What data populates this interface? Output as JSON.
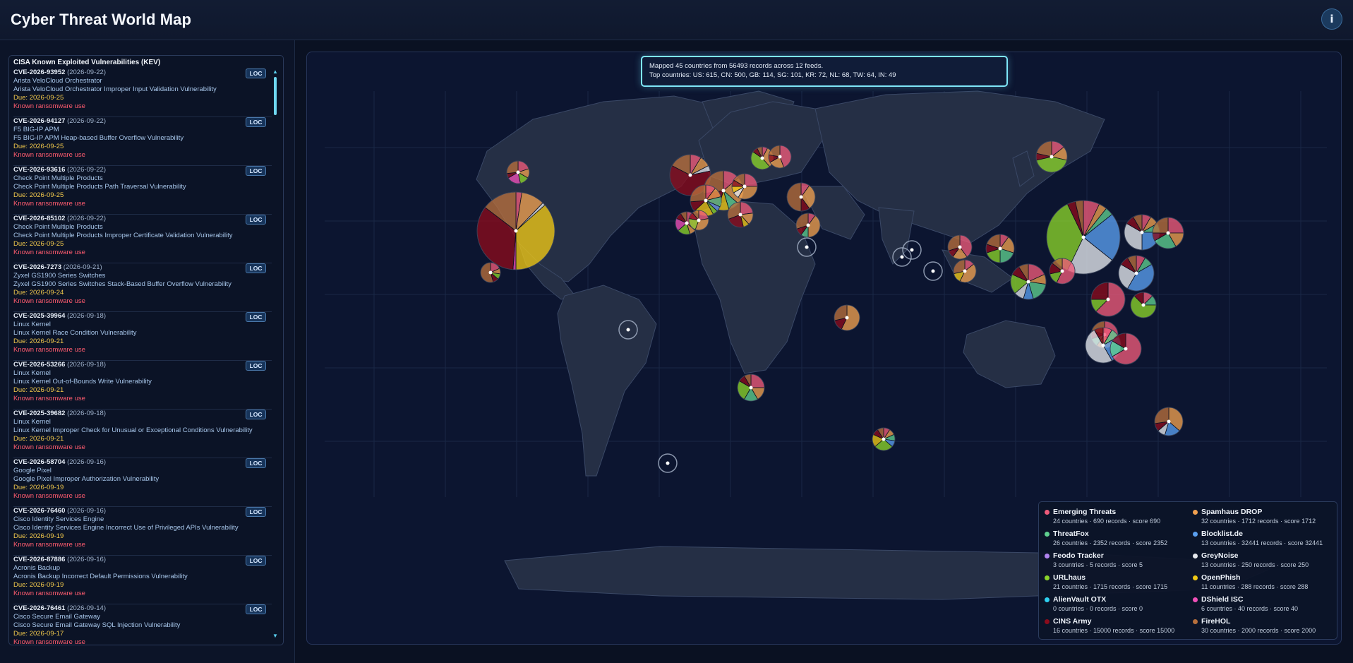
{
  "app": {
    "title": "Cyber Threat World Map",
    "info_label": "i"
  },
  "kev": {
    "title": "CISA Known Exploited Vulnerabilities (KEV)",
    "loc_label": "LOC",
    "items": [
      {
        "cve": "CVE-2026-93952",
        "date": "(2026-09-22)",
        "product": "Arista VeloCloud Orchestrator",
        "name": "Arista VeloCloud Orchestrator Improper Input Validation Vulnerability",
        "due": "Due: 2026-09-25",
        "ransom": "Known ransomware use"
      },
      {
        "cve": "CVE-2026-94127",
        "date": "(2026-09-22)",
        "product": "F5 BIG-IP APM",
        "name": "F5 BIG-IP APM Heap-based Buffer Overflow Vulnerability",
        "due": "Due: 2026-09-25",
        "ransom": "Known ransomware use"
      },
      {
        "cve": "CVE-2026-93616",
        "date": "(2026-09-22)",
        "product": "Check Point Multiple Products",
        "name": "Check Point Multiple Products Path Traversal Vulnerability",
        "due": "Due: 2026-09-25",
        "ransom": "Known ransomware use"
      },
      {
        "cve": "CVE-2026-85102",
        "date": "(2026-09-22)",
        "product": "Check Point Multiple Products",
        "name": "Check Point Multiple Products Improper Certificate Validation Vulnerability",
        "due": "Due: 2026-09-25",
        "ransom": "Known ransomware use"
      },
      {
        "cve": "CVE-2026-7273",
        "date": "(2026-09-21)",
        "product": "Zyxel GS1900 Series Switches",
        "name": "Zyxel GS1900 Series Switches Stack-Based Buffer Overflow Vulnerability",
        "due": "Due: 2026-09-24",
        "ransom": "Known ransomware use"
      },
      {
        "cve": "CVE-2025-39964",
        "date": "(2026-09-18)",
        "product": "Linux Kernel",
        "name": "Linux Kernel Race Condition Vulnerability",
        "due": "Due: 2026-09-21",
        "ransom": "Known ransomware use"
      },
      {
        "cve": "CVE-2026-53266",
        "date": "(2026-09-18)",
        "product": "Linux Kernel",
        "name": "Linux Kernel Out-of-Bounds Write Vulnerability",
        "due": "Due: 2026-09-21",
        "ransom": "Known ransomware use"
      },
      {
        "cve": "CVE-2025-39682",
        "date": "(2026-09-18)",
        "product": "Linux Kernel",
        "name": "Linux Kernel Improper Check for Unusual or Exceptional Conditions Vulnerability",
        "due": "Due: 2026-09-21",
        "ransom": "Known ransomware use"
      },
      {
        "cve": "CVE-2026-58704",
        "date": "(2026-09-16)",
        "product": "Google Pixel",
        "name": "Google Pixel Improper Authorization Vulnerability",
        "due": "Due: 2026-09-19",
        "ransom": "Known ransomware use"
      },
      {
        "cve": "CVE-2026-76460",
        "date": "(2026-09-16)",
        "product": "Cisco Identity Services Engine",
        "name": "Cisco Identity Services Engine Incorrect Use of Privileged APIs Vulnerability",
        "due": "Due: 2026-09-19",
        "ransom": "Known ransomware use"
      },
      {
        "cve": "CVE-2026-87886",
        "date": "(2026-09-16)",
        "product": "Acronis Backup",
        "name": "Acronis Backup Incorrect Default Permissions Vulnerability",
        "due": "Due: 2026-09-19",
        "ransom": "Known ransomware use"
      },
      {
        "cve": "CVE-2026-76461",
        "date": "(2026-09-14)",
        "product": "Cisco Secure Email Gateway",
        "name": "Cisco Secure Email Gateway SQL Injection Vulnerability",
        "due": "Due: 2026-09-17",
        "ransom": "Known ransomware use"
      }
    ]
  },
  "status": {
    "line1": "Mapped 45 countries from 56493 records across 12 feeds.",
    "line2": "Top countries: US: 615, CN: 500, GB: 114, SG: 101, KR: 72, NL: 68, TW: 64, IN: 49"
  },
  "legend": [
    {
      "name": "Emerging Threats",
      "stats": "24 countries · 690 records · score 690",
      "color": "#ef5b7a"
    },
    {
      "name": "Spamhaus DROP",
      "stats": "32 countries · 1712 records · score 1712",
      "color": "#f0a050"
    },
    {
      "name": "ThreatFox",
      "stats": "26 countries · 2352 records · score 2352",
      "color": "#5fd08f"
    },
    {
      "name": "Blocklist.de",
      "stats": "13 countries · 32441 records · score 32441",
      "color": "#5a9ff0"
    },
    {
      "name": "Feodo Tracker",
      "stats": "3 countries · 5 records · score 5",
      "color": "#b184f0"
    },
    {
      "name": "GreyNoise",
      "stats": "13 countries · 250 records · score 250",
      "color": "#e6e9ee"
    },
    {
      "name": "URLhaus",
      "stats": "21 countries · 1715 records · score 1715",
      "color": "#8bd42a"
    },
    {
      "name": "OpenPhish",
      "stats": "11 countries · 288 records · score 288",
      "color": "#f0c814"
    },
    {
      "name": "AlienVault OTX",
      "stats": "0 countries · 0 records · score 0",
      "color": "#2ed0f0"
    },
    {
      "name": "DShield ISC",
      "stats": "6 countries · 40 records · score 40",
      "color": "#f050b8"
    },
    {
      "name": "CINS Army",
      "stats": "16 countries · 15000 records · score 15000",
      "color": "#8b0c1c"
    },
    {
      "name": "FireHOL",
      "stats": "30 countries · 2000 records · score 2000",
      "color": "#b8703c"
    }
  ]
}
